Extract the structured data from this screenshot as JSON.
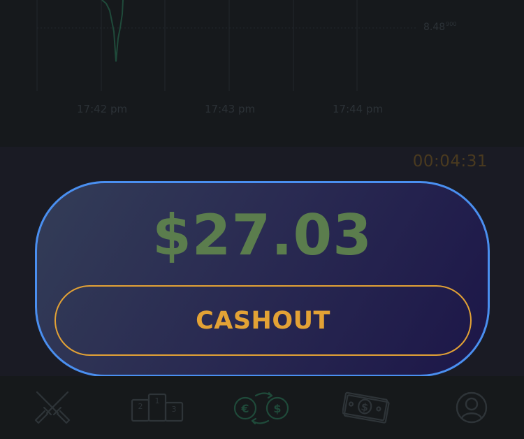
{
  "chart": {
    "time_ticks": [
      "17:42 pm",
      "17:43 pm",
      "17:44 pm"
    ],
    "price_label": "8.48",
    "price_label_sup": "900",
    "line_color": "#1f4a3a"
  },
  "timer": "00:04:31",
  "cashout": {
    "amount": "$27.03",
    "button_label": "CASHOUT",
    "accent_color": "#e3a235",
    "amount_color": "#5b7d4d",
    "border_color": "#4a8ff0"
  },
  "nav": {
    "items": [
      {
        "icon": "crossed-swords-icon",
        "active": false
      },
      {
        "icon": "leaderboard-podium-icon",
        "active": false
      },
      {
        "icon": "currency-exchange-icon",
        "active": true
      },
      {
        "icon": "cash-banknote-icon",
        "active": false
      },
      {
        "icon": "user-profile-icon",
        "active": false
      }
    ],
    "podium_digits": [
      "1",
      "2",
      "3"
    ],
    "exchange_symbols": [
      "€",
      "$"
    ],
    "banknote_symbol": "$"
  }
}
